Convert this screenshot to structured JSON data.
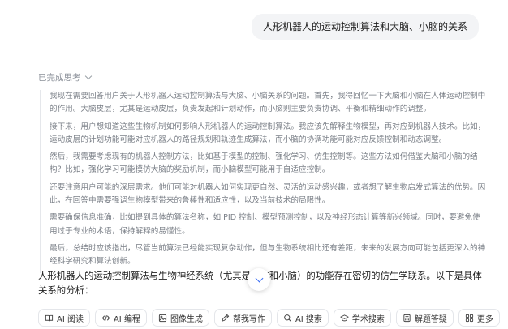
{
  "user_message": "人形机器人的运动控制算法和大脑、小脑的关系",
  "thinking": {
    "status_label": "已完成思考",
    "paragraphs": [
      "我现在需要回答用户关于人形机器人运动控制算法与大脑、小脑关系的问题。首先，我得回忆一下大脑和小脑在人体运动控制中的作用。大脑皮层，尤其是运动皮层，负责发起和计划动作，而小脑则主要负责协调、平衡和精细动作的调整。",
      "接下来，用户想知道这些生物机制如何影响人形机器人的运动控制算法。我应该先解释生物模型，再对应到机器人技术。比如，运动皮层的计划功能可能对应机器人的路径规划和轨迹生成算法，而小脑的协调功能可能对应反馈控制和动态调整。",
      "然后，我需要考虑现有的机器人控制方法，比如基于模型的控制、强化学习、仿生控制等。这些方法如何借鉴大脑和小脑的结构？比如，强化学习可能模仿大脑的奖励机制，而小脑模型可能用于自适应控制。",
      "还要注意用户可能的深层需求。他们可能对机器人如何实现更自然、灵活的运动感兴趣，或者想了解生物启发式算法的优势。因此，在回答中需要强调生物模型带来的鲁棒性和适应性，以及当前技术的局限性。",
      "需要确保信息准确，比如提到具体的算法名称，如 PID 控制、模型预测控制，以及神经形态计算等新兴领域。同时，要避免使用过于专业的术语，保持解释的易懂性。",
      "最后，总结时应该指出，尽管当前算法已经能实现复杂动作，但与生物系统相比还有差距，未来的发展方向可能包括更深入的神经科学研究和算法创新。"
    ]
  },
  "answer": {
    "text": "人形机器人的运动控制算法与生物神经系统（尤其是大脑和小脑）的功能存在密切的仿生学联系。以下是具体关系的分析："
  },
  "tools": [
    {
      "label": "AI 阅读",
      "icon": "book-icon"
    },
    {
      "label": "AI 编程",
      "icon": "code-icon"
    },
    {
      "label": "图像生成",
      "icon": "image-icon"
    },
    {
      "label": "帮我写作",
      "icon": "pen-icon"
    },
    {
      "label": "AI 搜索",
      "icon": "search-icon"
    },
    {
      "label": "学术搜索",
      "icon": "graduation-icon"
    },
    {
      "label": "解题答疑",
      "icon": "calculator-icon"
    },
    {
      "label": "更多",
      "icon": "grid-icon"
    }
  ],
  "colors": {
    "accent": "#3b6ef5",
    "thinking_text": "#7a7f87",
    "bubble_bg": "#f3f4f6"
  }
}
